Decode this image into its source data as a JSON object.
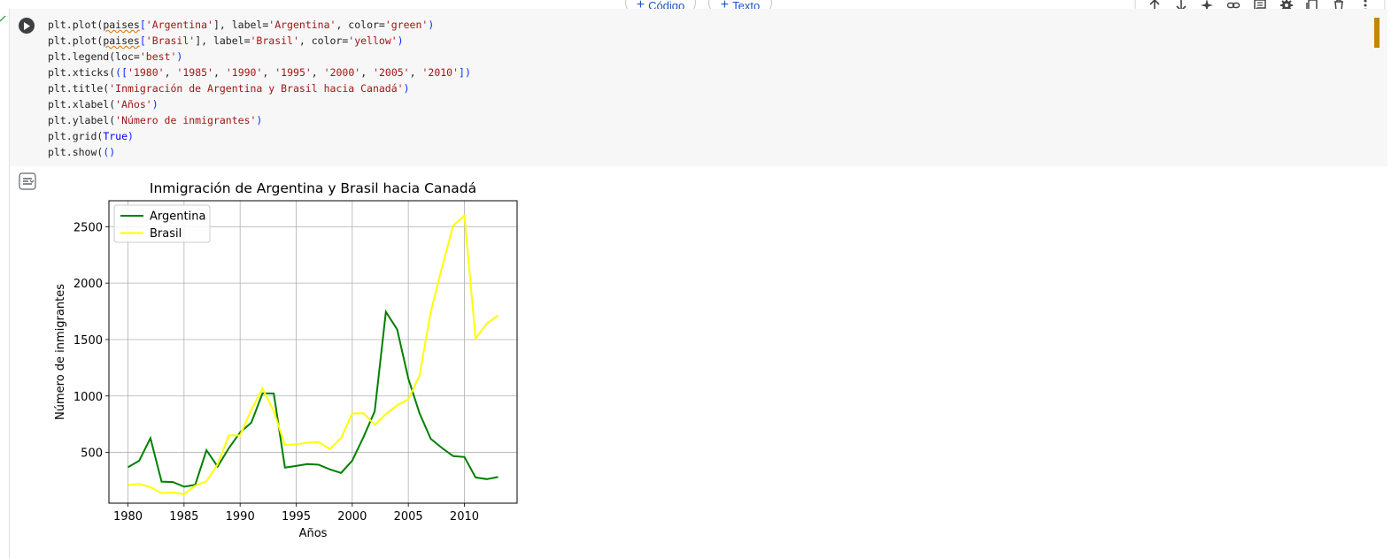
{
  "header": {
    "add_code_label": "Código",
    "add_text_label": "Texto"
  },
  "toolbar": {
    "icons": [
      "arrow-up-icon",
      "arrow-down-icon",
      "sparkle-icon",
      "link-icon",
      "comment-icon",
      "gear-icon",
      "mirror-cell-icon",
      "delete-icon",
      "more-vert-icon"
    ]
  },
  "cell": {
    "code_lines": [
      [
        {
          "t": "plt.plot("
        },
        {
          "t": "paises",
          "c": "sq"
        },
        {
          "t": "[",
          "c": "p"
        },
        {
          "t": "'Argentina'",
          "c": "s"
        },
        {
          "t": "], label=",
          "c": ""
        },
        {
          "t": "'Argentina'",
          "c": "s"
        },
        {
          "t": ", color="
        },
        {
          "t": "'green'",
          "c": "s"
        },
        {
          "t": ")",
          "c": "p"
        }
      ],
      [
        {
          "t": "plt.plot("
        },
        {
          "t": "paises",
          "c": "sq"
        },
        {
          "t": "[",
          "c": "p"
        },
        {
          "t": "'Brasil'",
          "c": "s"
        },
        {
          "t": "], label="
        },
        {
          "t": "'Brasil'",
          "c": "s"
        },
        {
          "t": ", color="
        },
        {
          "t": "'yellow'",
          "c": "s"
        },
        {
          "t": ")",
          "c": "p"
        }
      ],
      [
        {
          "t": "plt.legend(loc="
        },
        {
          "t": "'best'",
          "c": "s"
        },
        {
          "t": ")",
          "c": "p"
        }
      ],
      [
        {
          "t": "plt.xticks("
        },
        {
          "t": "([",
          "c": "p"
        },
        {
          "t": "'1980'",
          "c": "s"
        },
        {
          "t": ", "
        },
        {
          "t": "'1985'",
          "c": "s"
        },
        {
          "t": ", "
        },
        {
          "t": "'1990'",
          "c": "s"
        },
        {
          "t": ", "
        },
        {
          "t": "'1995'",
          "c": "s"
        },
        {
          "t": ", "
        },
        {
          "t": "'2000'",
          "c": "s"
        },
        {
          "t": ", "
        },
        {
          "t": "'2005'",
          "c": "s"
        },
        {
          "t": ", "
        },
        {
          "t": "'2010'",
          "c": "s"
        },
        {
          "t": "])",
          "c": "p"
        }
      ],
      [
        {
          "t": "plt.title("
        },
        {
          "t": "'Inmigración de Argentina y Brasil hacia Canadá'",
          "c": "s"
        },
        {
          "t": ")",
          "c": "p"
        }
      ],
      [
        {
          "t": "plt.xlabel("
        },
        {
          "t": "'Años'",
          "c": "s"
        },
        {
          "t": ")",
          "c": "p"
        }
      ],
      [
        {
          "t": "plt.ylabel("
        },
        {
          "t": "'Número de inmigrantes'",
          "c": "s"
        },
        {
          "t": ")",
          "c": "p"
        }
      ],
      [
        {
          "t": "plt.grid("
        },
        {
          "t": "True",
          "c": "kw"
        },
        {
          "t": ")",
          "c": "p"
        }
      ],
      [
        {
          "t": "plt.show("
        },
        {
          "t": "()",
          "c": "p"
        }
      ]
    ]
  },
  "chart_data": {
    "type": "line",
    "title": "Inmigración de Argentina y Brasil hacia Canadá",
    "xlabel": "Años",
    "ylabel": "Número de inmigrantes",
    "xlim": [
      1978.3,
      2014.7
    ],
    "ylim": [
      50,
      2730
    ],
    "xticks": [
      1980,
      1985,
      1990,
      1995,
      2000,
      2005,
      2010
    ],
    "yticks": [
      500,
      1000,
      1500,
      2000,
      2500
    ],
    "grid": true,
    "legend": "top-left",
    "x": [
      1980,
      1981,
      1982,
      1983,
      1984,
      1985,
      1986,
      1987,
      1988,
      1989,
      1990,
      1991,
      1992,
      1993,
      1994,
      1995,
      1996,
      1997,
      1998,
      1999,
      2000,
      2001,
      2002,
      2003,
      2004,
      2005,
      2006,
      2007,
      2008,
      2009,
      2010,
      2011,
      2012,
      2013
    ],
    "series": [
      {
        "name": "Argentina",
        "color": "#008000",
        "values": [
          368,
          426,
          626,
          241,
          237,
          196,
          213,
          519,
          374,
          538,
          678,
          763,
          1023,
          1022,
          366,
          380,
          396,
          391,
          349,
          318,
          427,
          635,
          865,
          1745,
          1591,
          1153,
          847,
          620,
          540,
          467,
          459,
          278,
          263,
          282
        ]
      },
      {
        "name": "Brasil",
        "color": "#ffff00",
        "values": [
          211,
          220,
          192,
          139,
          145,
          130,
          205,
          244,
          394,
          650,
          650,
          877,
          1066,
          866,
          566,
          572,
          586,
          591,
          531,
          626,
          845,
          847,
          745,
          839,
          917,
          969,
          1181,
          1746,
          2138,
          2509,
          2598,
          1508,
          1642,
          1714
        ]
      }
    ]
  }
}
